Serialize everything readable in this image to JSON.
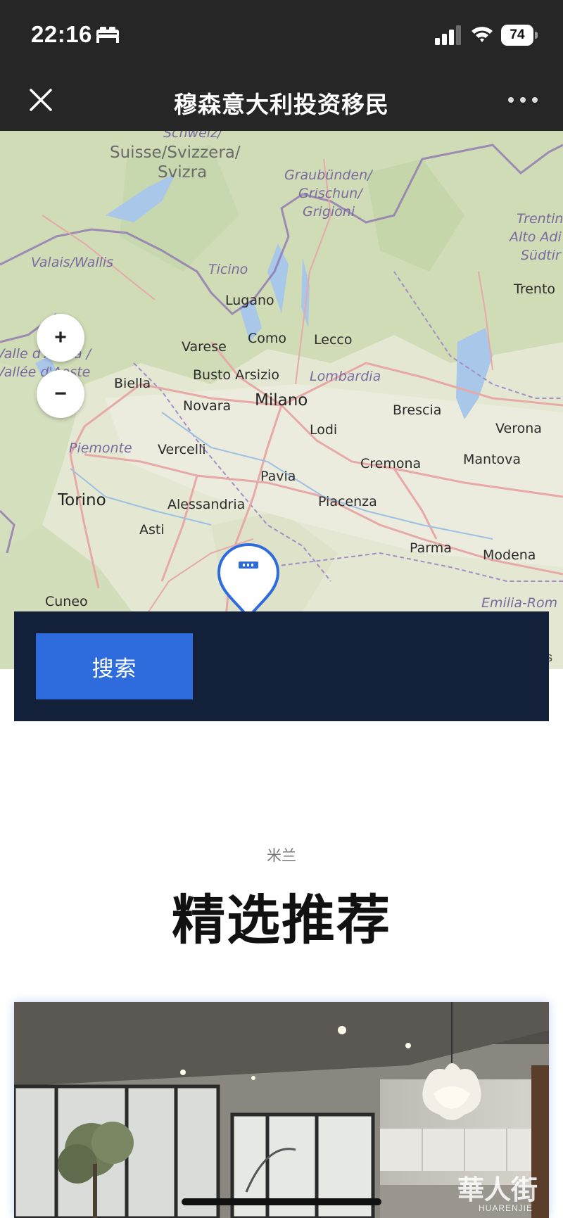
{
  "status_bar": {
    "time": "22:16",
    "battery": "74",
    "icons": [
      "sleep-mode-icon",
      "cellular-signal-icon",
      "wifi-icon",
      "battery-icon"
    ]
  },
  "title_bar": {
    "title": "穆森意大利投资移民",
    "close_icon": "close-icon",
    "more_icon": "more-icon"
  },
  "map": {
    "zoom_in": "+",
    "zoom_out": "−",
    "attribution_fragment": "s",
    "labels": {
      "schweiz": "Schweiz/",
      "suisse": "Suisse/Svizzera/",
      "svizra": "Svizra",
      "graubunden": "Graubünden/",
      "grischun": "Grischun/",
      "grigioni": "Grigioni",
      "trentino": "Trentin",
      "alto_adige": "Alto Adi",
      "sudtirol": "Südtir",
      "valais": "Valais/Wallis",
      "ticino": "Ticino",
      "lugano": "Lugano",
      "trento": "Trento",
      "valle_daosta_1": "Valle d'Aosta /",
      "valle_daosta_2": "Vallée d'Aoste",
      "varese": "Varese",
      "como": "Como",
      "lecco": "Lecco",
      "biella": "Biella",
      "busto_arsizio": "Busto Arsizio",
      "lombardia": "Lombardia",
      "novara": "Novara",
      "milano": "Milano",
      "brescia": "Brescia",
      "verona": "Verona",
      "lodi": "Lodi",
      "piemonte": "Piemonte",
      "vercelli": "Vercelli",
      "mantova": "Mantova",
      "cremona": "Cremona",
      "pavia": "Pavia",
      "torino": "Torino",
      "alessandria": "Alessandria",
      "piacenza": "Piacenza",
      "asti": "Asti",
      "parma": "Parma",
      "modena": "Modena",
      "cuneo": "Cuneo",
      "emilia_romagna": "Emilia-Rom"
    }
  },
  "search": {
    "button_label": "搜索"
  },
  "section": {
    "subtitle": "米兰",
    "title": "精选推荐"
  },
  "watermark": {
    "text": "華人街",
    "sub": "HUARENJIE"
  }
}
